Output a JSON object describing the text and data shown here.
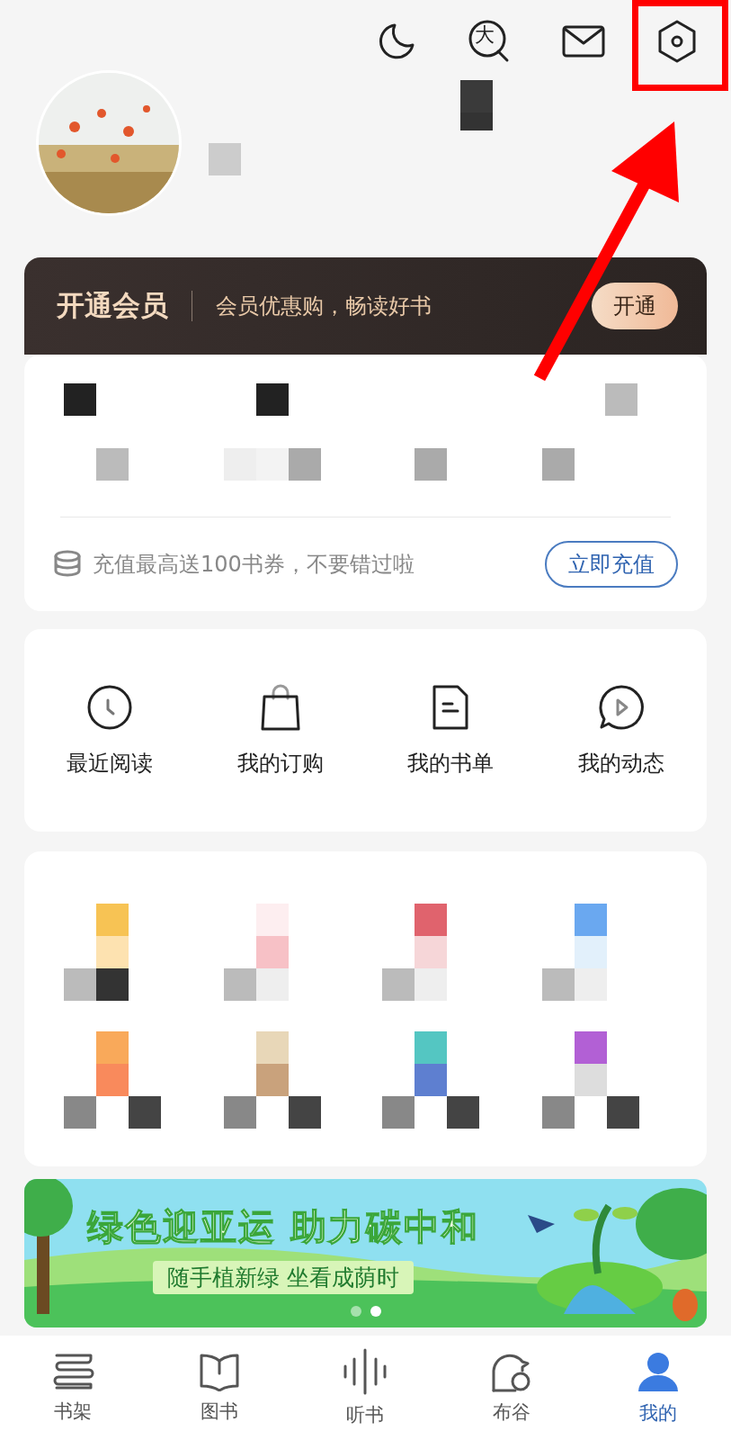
{
  "top_actions": [
    {
      "kind": "night"
    },
    {
      "kind": "font",
      "glyph": "大"
    },
    {
      "kind": "mail"
    },
    {
      "kind": "settings"
    }
  ],
  "member": {
    "title": "开通会员",
    "slogan": "会员优惠购，畅读好书",
    "button": "开通"
  },
  "recharge": {
    "text": "充值最高送100书券，不要错过啦",
    "button": "立即充值"
  },
  "shortcuts": [
    {
      "kind": "clock",
      "label": "最近阅读"
    },
    {
      "kind": "bag",
      "label": "我的订购"
    },
    {
      "kind": "doc",
      "label": "我的书单"
    },
    {
      "kind": "chat",
      "label": "我的动态"
    }
  ],
  "banner": {
    "title": "绿色迎亚运 助力碳中和",
    "subtitle": "随手植新绿 坐看成荫时",
    "pages": [
      {
        "selected": false
      },
      {
        "selected": true
      }
    ]
  },
  "tab_bar": [
    {
      "kind": "shelf",
      "label": "书架",
      "selected": false
    },
    {
      "kind": "book",
      "label": "图书",
      "selected": false
    },
    {
      "kind": "audio",
      "label": "听书",
      "selected": false
    },
    {
      "kind": "bird",
      "label": "布谷",
      "selected": false
    },
    {
      "kind": "person",
      "label": "我的",
      "selected": true
    }
  ]
}
